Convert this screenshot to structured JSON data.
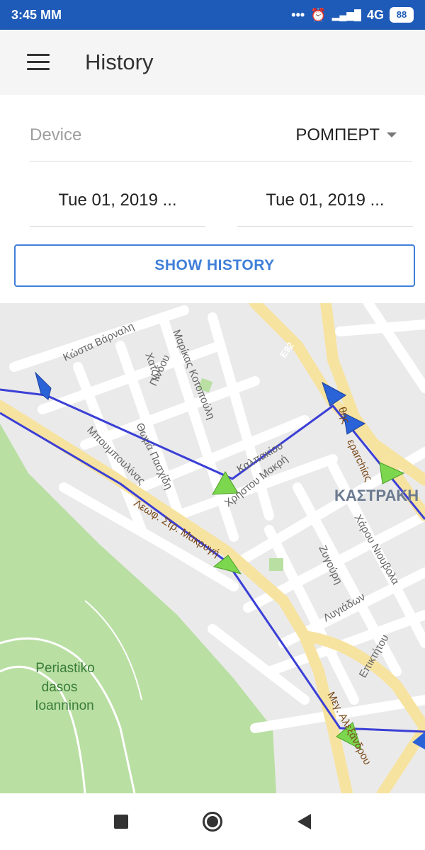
{
  "status": {
    "time": "3:45 MM",
    "icons": [
      "dots-icon",
      "alarm-icon",
      "signal-icon",
      "network-4g-icon",
      "battery-icon"
    ],
    "dots": "•••",
    "alarm": "⏰",
    "signal": "▂▄▆█",
    "network": "4G",
    "battery": "88"
  },
  "appbar": {
    "title": "History"
  },
  "form": {
    "device_label": "Device",
    "device_value": "ΡΟΜΠΕΡΤ",
    "date_from": "Tue 01, 2019 ...",
    "date_to": "Tue 01, 2019 ...",
    "show_button": "SHOW HISTORY"
  },
  "map": {
    "labels": {
      "kosta": "Κώστα Βάρναλη",
      "marikas": "Μαρίκας Κοτοπούλη",
      "xatzi": "Χατζή",
      "pindou": "Πίνδου",
      "thoma": "Θωμά Πασχίδη",
      "mpoumpoulinas": "Μπουμπουλίνας",
      "kalpakiou": "Καλπακίου",
      "xristou": "Χρήστου Μακρή",
      "leof": "Λεωφ. Στρ. Μακρυγ",
      "leof_end": "ή",
      "e92": "Ε92",
      "ierarxias": "ερarchίας",
      "vth": "θης",
      "kastraki": "ΚΑΣΤΡΑΚΗ",
      "xarou": "Χάρου Νιουβολα",
      "zygouri": "Ζυγούρη",
      "lygiadon": "Λυγιάδων",
      "epiktitou": "Επικτήτου",
      "meg_al": "Μεγ. Αλεξάνδρου",
      "park_line1": "Periastiko",
      "park_line2": "dasos",
      "park_line3": "Ioanninon"
    },
    "colors": {
      "route": "#3b3fd6",
      "road_major": "#f7e3a0",
      "park": "#b9dfa3",
      "blue_marker": "#2a62d8",
      "green_marker": "#7cd64e"
    }
  },
  "navbar": {
    "icons": [
      "recents-square-icon",
      "home-circle-icon",
      "back-triangle-icon"
    ]
  }
}
